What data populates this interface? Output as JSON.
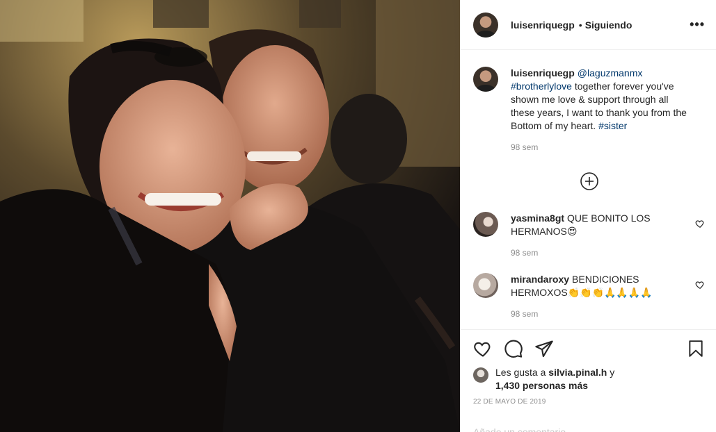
{
  "post": {
    "author": "luisenriquegp",
    "separator": "•",
    "follow_status": "Siguiendo",
    "more_label": "•••"
  },
  "caption": {
    "user": "luisenriquegp",
    "mention": "@laguzmanmx",
    "hashtag1": "#brotherlylove",
    "text": " together forever you've shown me love & support through all these years, I want to thank you from the Bottom of my heart. ",
    "hashtag2": "#sister",
    "time": "98 sem"
  },
  "comments": [
    {
      "user": "yasmina8gt",
      "text": "QUE BONITO LOS HERMANOS",
      "emoji": "😍",
      "time": "98 sem"
    },
    {
      "user": "mirandaroxy",
      "text": "BENDICIONES HERMOXOS",
      "emoji": "👏👏👏🙏🙏🙏🙏",
      "time": "98 sem"
    }
  ],
  "likes": {
    "prefix": "Les gusta a ",
    "liker": "silvia.pinal.h",
    "conj": " y",
    "others": "1,430 personas más"
  },
  "date": "22 DE MAYO DE 2019",
  "add_comment_placeholder": "Añade un comentario...",
  "icons": {
    "like": "heart-icon",
    "comment": "comment-icon",
    "share": "share-icon",
    "save": "bookmark-icon",
    "load_more": "plus-circle-icon"
  },
  "colors": {
    "link": "#00376b",
    "muted": "#8e8e8e",
    "text": "#262626",
    "emoji_heart_eyes": "#e0245e"
  }
}
